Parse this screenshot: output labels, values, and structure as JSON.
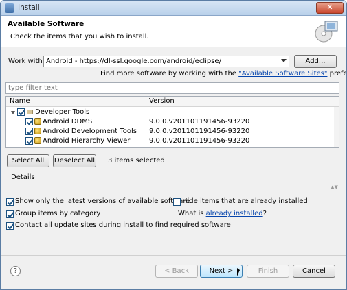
{
  "window": {
    "title": "Install",
    "close_glyph": "✕"
  },
  "header": {
    "title": "Available Software",
    "subtitle": "Check the items that you wish to install."
  },
  "work_with": {
    "label": "Work with:",
    "value": "Android - https://dl-ssl.google.com/android/eclipse/",
    "add_label": "Add...",
    "find_more_prefix": "Find more software by working with the ",
    "find_more_link": "\"Available Software Sites\"",
    "find_more_suffix": " preferences."
  },
  "filter": {
    "placeholder": "type filter text"
  },
  "table": {
    "columns": [
      "Name",
      "Version"
    ],
    "category": {
      "name": "Developer Tools",
      "checked": true
    },
    "rows": [
      {
        "name": "Android DDMS",
        "version": "9.0.0.v201101191456-93220",
        "checked": true
      },
      {
        "name": "Android Development Tools",
        "version": "9.0.0.v201101191456-93220",
        "checked": true
      },
      {
        "name": "Android Hierarchy Viewer",
        "version": "9.0.0.v201101191456-93220",
        "checked": true
      }
    ]
  },
  "selection": {
    "select_all": "Select All",
    "deselect_all": "Deselect All",
    "status": "3 items selected"
  },
  "details": {
    "label": "Details",
    "arrows": "▲▼"
  },
  "options": {
    "show_latest": {
      "label": "Show only the latest versions of available software",
      "checked": true
    },
    "hide_installed": {
      "label": "Hide items that are already installed",
      "checked": false
    },
    "group_by_category": {
      "label": "Group items by category",
      "checked": true
    },
    "what_is_prefix": "What is ",
    "what_is_link": "already installed",
    "what_is_suffix": "?",
    "contact_sites": {
      "label": "Contact all update sites during install to find required software",
      "checked": true
    }
  },
  "footer": {
    "help_glyph": "?",
    "back": "< Back",
    "next": "Next >",
    "finish": "Finish",
    "cancel": "Cancel"
  }
}
